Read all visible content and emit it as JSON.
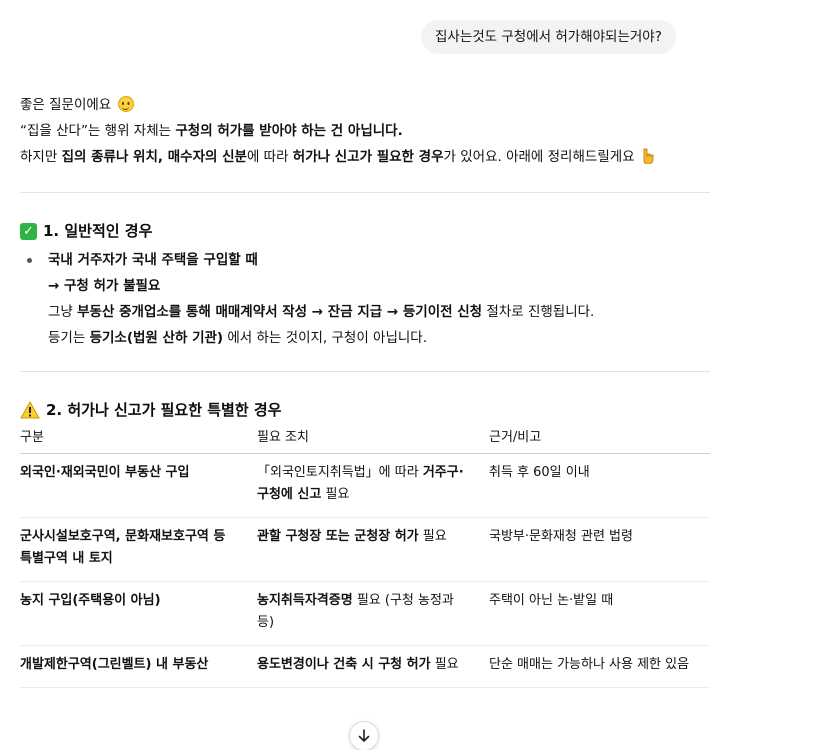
{
  "user_message": "집사는것도 구청에서 허가해야되는거야?",
  "intro": {
    "line1": "좋은 질문이에요",
    "line2_pre": "“집을 산다”는 행위 자체는 ",
    "line2_bold": "구청의 허가를 받아야 하는 건 아닙니다.",
    "line3_pre": "하지만 ",
    "line3_bold1": "집의 종류나 위치, 매수자의 신분",
    "line3_mid": "에 따라 ",
    "line3_bold2": "허가나 신고가 필요한 경우",
    "line3_post": "가 있어요. 아래에 정리해드릴게요"
  },
  "section1": {
    "icon": "check-mark-icon",
    "title": "1. 일반적인 경우",
    "bullet_bold": "국내 거주자가 국내 주택을 구입할 때",
    "arrow_line": "→ 구청 허가 불필요",
    "line3_pre": "그냥 ",
    "line3_bold": "부동산 중개업소를 통해 매매계약서 작성 → 잔금 지급 → 등기이전 신청",
    "line3_post": " 절차로 진행됩니다.",
    "line4_pre": "등기는 ",
    "line4_bold": "등기소(법원 산하 기관)",
    "line4_post": " 에서 하는 것이지, 구청이 아닙니다."
  },
  "section2": {
    "icon": "warning-icon",
    "title": "2. 허가나 신고가 필요한 특별한 경우",
    "headers": [
      "구분",
      "필요 조치",
      "근거/비고"
    ],
    "rows": [
      {
        "c1": "외국인·재외국민이 부동산 구입",
        "c2_pre": "「외국인토지취득법」에 따라 ",
        "c2_bold": "거주구·구청에 신고",
        "c2_post": " 필요",
        "c3": "취득 후 60일 이내"
      },
      {
        "c1": "군사시설보호구역, 문화재보호구역 등 특별구역 내 토지",
        "c2_pre": "",
        "c2_bold": "관할 구청장 또는 군청장 허가",
        "c2_post": " 필요",
        "c3": "국방부·문화재청 관련 법령"
      },
      {
        "c1": "농지 구입(주택용이 아님)",
        "c2_pre": "",
        "c2_bold": "농지취득자격증명",
        "c2_post": " 필요 (구청 농정과 등)",
        "c3": "주택이 아닌 논·밭일 때"
      },
      {
        "c1": "개발제한구역(그린벨트) 내 부동산",
        "c2_pre": "",
        "c2_bold": "용도변경이나 건축 시 구청 허가",
        "c2_post": " 필요",
        "c3": "단순 매매는 가능하나 사용 제한 있음"
      }
    ]
  },
  "scroll_button_icon": "arrow-down-icon"
}
